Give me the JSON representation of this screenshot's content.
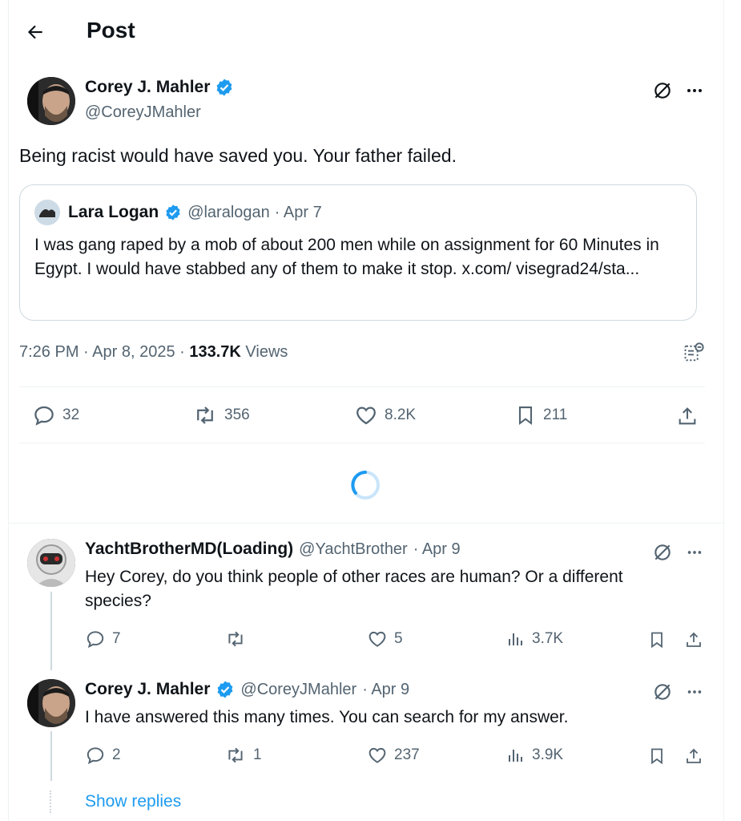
{
  "header": {
    "title": "Post"
  },
  "colors": {
    "accent": "#1d9bf0",
    "muted": "#536471",
    "text": "#0f1419",
    "border": "#cfd9de"
  },
  "post": {
    "author_name": "Corey J. Mahler",
    "author_handle": "@CoreyJMahler",
    "text": "Being racist would have saved you. Your father failed.",
    "quote": {
      "author_name": "Lara Logan",
      "author_handle": "@laralogan",
      "date": "· Apr 7",
      "text": "I was gang raped by a mob of about 200 men while on assignment for 60 Minutes in Egypt. I would have stabbed any of them to make it stop. x.com/ visegrad24/sta..."
    },
    "time": "7:26 PM · Apr 8, 2025 · ",
    "views_count": "133.7K",
    "views_label": " Views",
    "stats": {
      "replies": "32",
      "reposts": "356",
      "likes": "8.2K",
      "bookmarks": "211"
    }
  },
  "replies": [
    {
      "author_name": "YachtBrotherMD(Loading)",
      "author_handle": "@YachtBrother",
      "date": "· Apr 9",
      "text": "Hey Corey, do you think people of other races are human? Or a different species?",
      "stats": {
        "replies": "7",
        "reposts": "",
        "likes": "5",
        "views": "3.7K"
      }
    },
    {
      "author_name": "Corey J. Mahler",
      "author_handle": "@CoreyJMahler",
      "date": "· Apr 9",
      "text": "I have answered this many times. You can search for my answer.",
      "stats": {
        "replies": "2",
        "reposts": "1",
        "likes": "237",
        "views": "3.9K"
      }
    }
  ],
  "show_replies": "Show replies",
  "icons": [
    "back-arrow-icon",
    "verified-icon",
    "grok-icon",
    "more-icon",
    "reply-icon",
    "repost-icon",
    "like-icon",
    "bookmark-icon",
    "share-icon",
    "views-icon",
    "analytics-icon",
    "loading-spinner-icon"
  ]
}
